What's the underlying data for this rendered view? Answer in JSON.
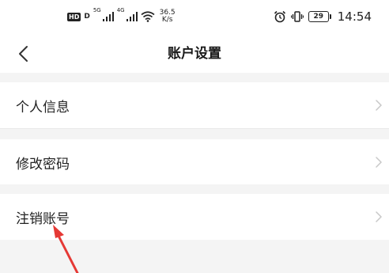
{
  "status_bar": {
    "hd_badge": "HD",
    "sim_badge": "D",
    "network_1": "5G",
    "network_2": "4G",
    "speed_value": "36.5",
    "speed_unit": "K/s",
    "battery_level": "29",
    "time": "14:54"
  },
  "nav": {
    "title": "账户设置",
    "back_icon": "chevron-left-icon"
  },
  "settings": {
    "items": [
      {
        "label": "个人信息",
        "icon": "chevron-right-icon"
      },
      {
        "label": "修改密码",
        "icon": "chevron-right-icon"
      },
      {
        "label": "注销账号",
        "icon": "chevron-right-icon"
      }
    ]
  },
  "colors": {
    "background": "#f4f4f4",
    "surface": "#ffffff",
    "text_primary": "#222222",
    "chevron": "#c8c8c8",
    "annotation_arrow": "#e53935"
  }
}
